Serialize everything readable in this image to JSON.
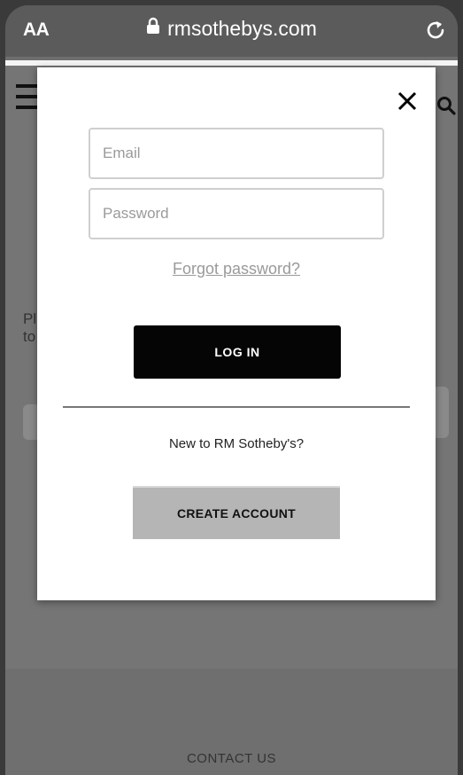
{
  "browser": {
    "text_size_label": "AA",
    "url": "rmsothebys.com"
  },
  "background_page": {
    "text_line_1": "Pl",
    "text_line_2": "to",
    "footer_link": "CONTACT US"
  },
  "login_modal": {
    "email_placeholder": "Email",
    "password_placeholder": "Password",
    "forgot_password_link": "Forgot password?",
    "login_button": "LOG IN",
    "new_customer_text": "New to RM Sotheby's?",
    "create_account_button": "CREATE ACCOUNT"
  },
  "icons": {
    "lock": "lock-icon",
    "reload": "reload-icon",
    "close": "close-icon",
    "menu": "hamburger-menu-icon",
    "search": "search-icon"
  },
  "colors": {
    "login_button_bg": "#050505",
    "create_button_bg": "#b5b5b5",
    "overlay": "#757575"
  }
}
